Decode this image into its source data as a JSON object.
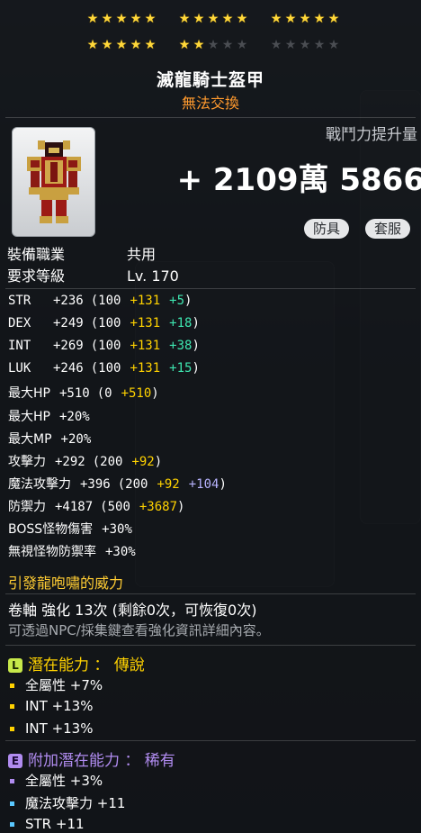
{
  "stars": {
    "row1": [
      [
        1,
        1,
        1,
        1,
        1
      ],
      [
        1,
        1,
        1,
        1,
        1
      ],
      [
        1,
        1,
        1,
        1,
        1
      ]
    ],
    "row2": [
      [
        1,
        1,
        1,
        1,
        1
      ],
      [
        1,
        1,
        0,
        0,
        0
      ],
      [
        0,
        0,
        0,
        0,
        0
      ]
    ]
  },
  "item": {
    "name": "滅龍騎士盔甲",
    "trade_status": "無法交換"
  },
  "combat_power": {
    "label": "戰鬥力提升量",
    "value": "+ 2109萬 5866"
  },
  "tags": [
    "防具",
    "套服"
  ],
  "requirements": [
    {
      "key": "裝備職業",
      "value": "共用"
    },
    {
      "key": "要求等級",
      "value": "Lv. 170"
    }
  ],
  "stats": [
    {
      "label": "STR",
      "total": "+236",
      "base": "(100",
      "bonus": "+131",
      "extra": "+5",
      "extra_color": "grn",
      "close": ")"
    },
    {
      "label": "DEX",
      "total": "+249",
      "base": "(100",
      "bonus": "+131",
      "extra": "+18",
      "extra_color": "grn",
      "close": ")"
    },
    {
      "label": "INT",
      "total": "+269",
      "base": "(100",
      "bonus": "+131",
      "extra": "+38",
      "extra_color": "grn",
      "close": ")"
    },
    {
      "label": "LUK",
      "total": "+246",
      "base": "(100",
      "bonus": "+131",
      "extra": "+15",
      "extra_color": "grn",
      "close": ")"
    },
    {
      "label": "最大HP",
      "total": "+510",
      "base": "(0",
      "bonus": "+510",
      "extra": "",
      "extra_color": "",
      "close": ")"
    },
    {
      "label": "最大HP",
      "total": "+20%",
      "base": "",
      "bonus": "",
      "extra": "",
      "extra_color": "",
      "close": ""
    },
    {
      "label": "最大MP",
      "total": "+20%",
      "base": "",
      "bonus": "",
      "extra": "",
      "extra_color": "",
      "close": ""
    },
    {
      "label": "攻擊力",
      "total": "+292",
      "base": "(200",
      "bonus": "+92",
      "extra": "",
      "extra_color": "",
      "close": ")"
    },
    {
      "label": "魔法攻擊力",
      "total": "+396",
      "base": "(200",
      "bonus": "+92",
      "extra": "+104",
      "extra_color": "blu",
      "close": ")"
    },
    {
      "label": "防禦力",
      "total": "+4187",
      "base": "(500",
      "bonus": "+3687",
      "extra": "",
      "extra_color": "",
      "close": ")"
    },
    {
      "label": "BOSS怪物傷害",
      "total": "+30%",
      "base": "",
      "bonus": "",
      "extra": "",
      "extra_color": "",
      "close": ""
    },
    {
      "label": "無視怪物防禦率",
      "total": "+30%",
      "base": "",
      "bonus": "",
      "extra": "",
      "extra_color": "",
      "close": ""
    }
  ],
  "set_effect": "引發龍咆嘯的威力",
  "scroll": {
    "text": "卷軸 強化 13次 (剩餘0次，可恢復0次)",
    "hint": "可透過NPC/採集鍵查看強化資訊詳細內容。"
  },
  "potential": {
    "badge": "L",
    "title": "潛在能力 ： 傳說",
    "lines": [
      "全屬性 +7%",
      "INT +13%",
      "INT +13%"
    ],
    "color": "#c7e84a"
  },
  "bonus_potential": {
    "badge": "E",
    "title": "附加潛在能力 ： 稀有",
    "lines": [
      "全屬性 +3%",
      "魔法攻擊力 +11",
      "STR +11"
    ],
    "color": "#b18cf0",
    "dot_colors": [
      "#b18cf0",
      "#5ac8ff",
      "#5ac8ff"
    ]
  }
}
